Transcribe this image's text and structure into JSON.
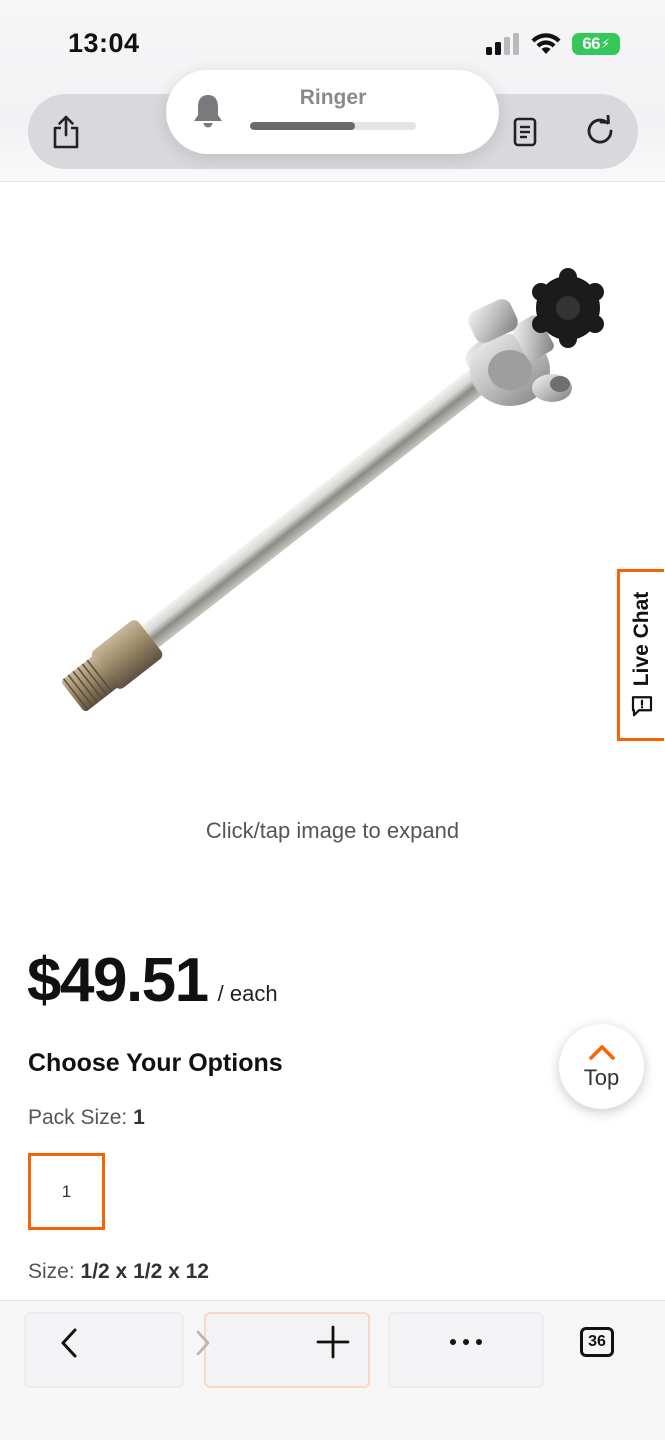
{
  "status_bar": {
    "time": "13:04",
    "battery": "66",
    "icons": [
      "cellular-signal-icon",
      "wifi-icon",
      "battery-charging-icon"
    ]
  },
  "ringer_hud": {
    "label": "Ringer",
    "level_fraction": 0.63,
    "icon": "bell-icon"
  },
  "browser_top": {
    "icons": [
      "share-icon",
      "reader-icon",
      "reload-icon"
    ]
  },
  "product": {
    "image_icon": "outdoor-faucet-sillcock-image",
    "expand_hint": "Click/tap image to expand",
    "price": "$49.51",
    "price_unit": "/ each",
    "options_title": "Choose Your Options",
    "pack_size_label": "Pack Size:",
    "pack_size_value": "1",
    "pack_options": [
      "1"
    ],
    "size_label": "Size:",
    "size_value": "1/2 x 1/2 x 12"
  },
  "live_chat": {
    "label": "Live Chat",
    "icon": "chat-bubble-icon"
  },
  "scroll_top": {
    "label": "Top",
    "icon": "chevron-up-icon"
  },
  "browser_bottom": {
    "tab_count": "36",
    "icons": [
      "back-chevron-icon",
      "forward-chevron-icon",
      "plus-icon",
      "more-icon",
      "tabs-icon"
    ]
  },
  "colors": {
    "accent": "#f96302",
    "battery_green": "#34c759"
  }
}
